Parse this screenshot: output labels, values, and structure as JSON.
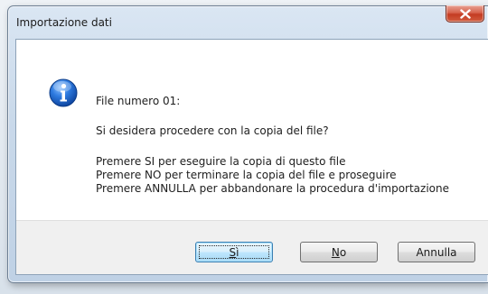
{
  "window": {
    "title": "Importazione dati"
  },
  "message": {
    "icon": "info-icon",
    "line1": "File numero 01:",
    "line2": "Si desidera procedere con la copia del file?",
    "line3": "Premere SI per eseguire la copia di questo file",
    "line4": "Premere NO per terminare la copia del file e proseguire",
    "line5": "Premere ANNULLA per abbandonare la procedura d'importazione"
  },
  "buttons": {
    "yes_label": "Sì",
    "no_label": "No",
    "cancel_label": "Annulla"
  },
  "colors": {
    "close_button": "#c43c22",
    "info_icon": "#1c62c4",
    "default_button_border": "#3c7fb1"
  }
}
